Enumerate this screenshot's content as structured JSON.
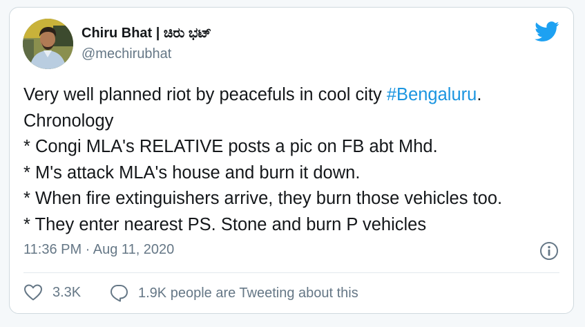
{
  "author": {
    "name": "Chiru Bhat | ಚಿರು ಭಟ್",
    "handle": "@mechirubhat"
  },
  "tweet": {
    "line1_text": "Very well planned riot by peacefuls in cool city ",
    "line1_hashtag": "#Bengaluru",
    "line1_end": ".",
    "line2": "Chronology",
    "line3": "* Congi MLA's RELATIVE posts a pic on FB abt Mhd.",
    "line4": "* M's attack MLA's house and burn it down.",
    "line5": "* When fire extinguishers arrive, they burn those vehicles too.",
    "line6": "* They enter nearest PS. Stone and burn P vehicles"
  },
  "timestamp": "11:36 PM · Aug 11, 2020",
  "actions": {
    "likes": "3.3K",
    "discussion": "1.9K people are Tweeting about this"
  },
  "icons": {
    "brand": "twitter-bird-icon",
    "info": "info-icon",
    "like": "heart-icon",
    "reply": "speech-bubble-icon"
  },
  "colors": {
    "brand": "#1da1f2",
    "hashtag": "#1b95e0",
    "secondary_text": "#657786",
    "primary_text": "#14171a"
  }
}
